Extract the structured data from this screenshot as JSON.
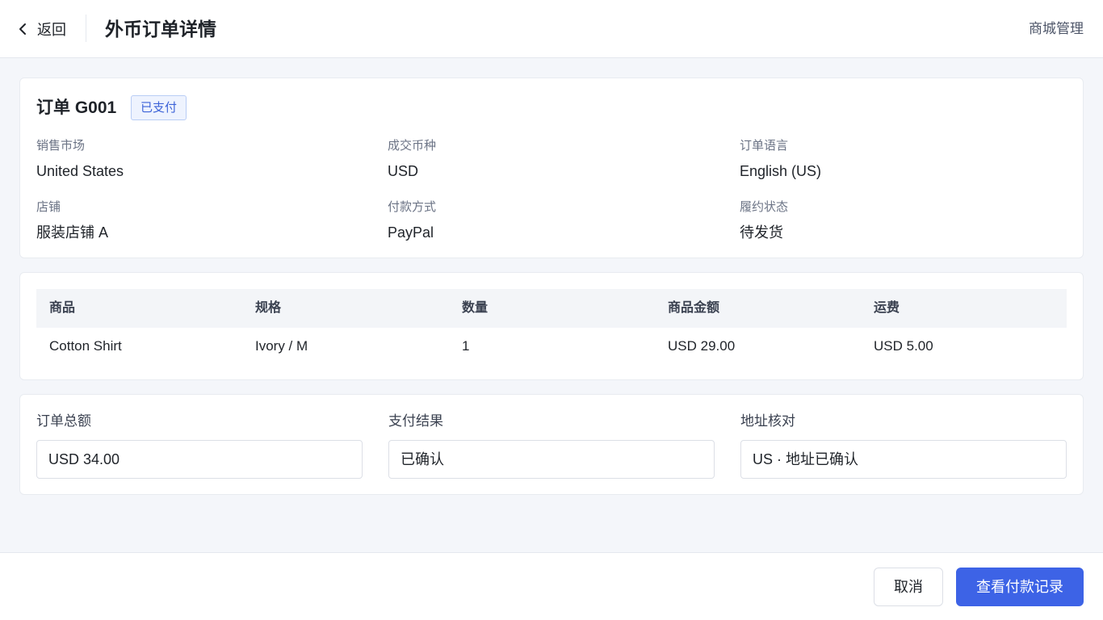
{
  "header": {
    "back_label": "返回",
    "title": "外币订单详情",
    "right_link": "商城管理"
  },
  "order": {
    "title": "订单 G001",
    "status_badge": "已支付",
    "fields": [
      {
        "label": "销售市场",
        "value": "United States"
      },
      {
        "label": "成交币种",
        "value": "USD"
      },
      {
        "label": "订单语言",
        "value": "English (US)"
      },
      {
        "label": "店铺",
        "value": "服装店铺 A"
      },
      {
        "label": "付款方式",
        "value": "PayPal"
      },
      {
        "label": "履约状态",
        "value": "待发货"
      }
    ]
  },
  "items_table": {
    "columns": [
      "商品",
      "规格",
      "数量",
      "商品金额",
      "运费"
    ],
    "rows": [
      [
        "Cotton Shirt",
        "Ivory / M",
        "1",
        "USD 29.00",
        "USD 5.00"
      ]
    ]
  },
  "summary": {
    "fields": [
      {
        "label": "订单总额",
        "value": "USD 34.00"
      },
      {
        "label": "支付结果",
        "value": "已确认"
      },
      {
        "label": "地址核对",
        "value": "US · 地址已确认"
      }
    ]
  },
  "footer": {
    "cancel_label": "取消",
    "primary_label": "查看付款记录"
  },
  "colors": {
    "primary": "#3d63e6",
    "badge_bg": "#eef3fe",
    "badge_text": "#3d63d8",
    "page_bg": "#f4f6fa"
  },
  "icons": {
    "back": "chevron-left-icon"
  }
}
